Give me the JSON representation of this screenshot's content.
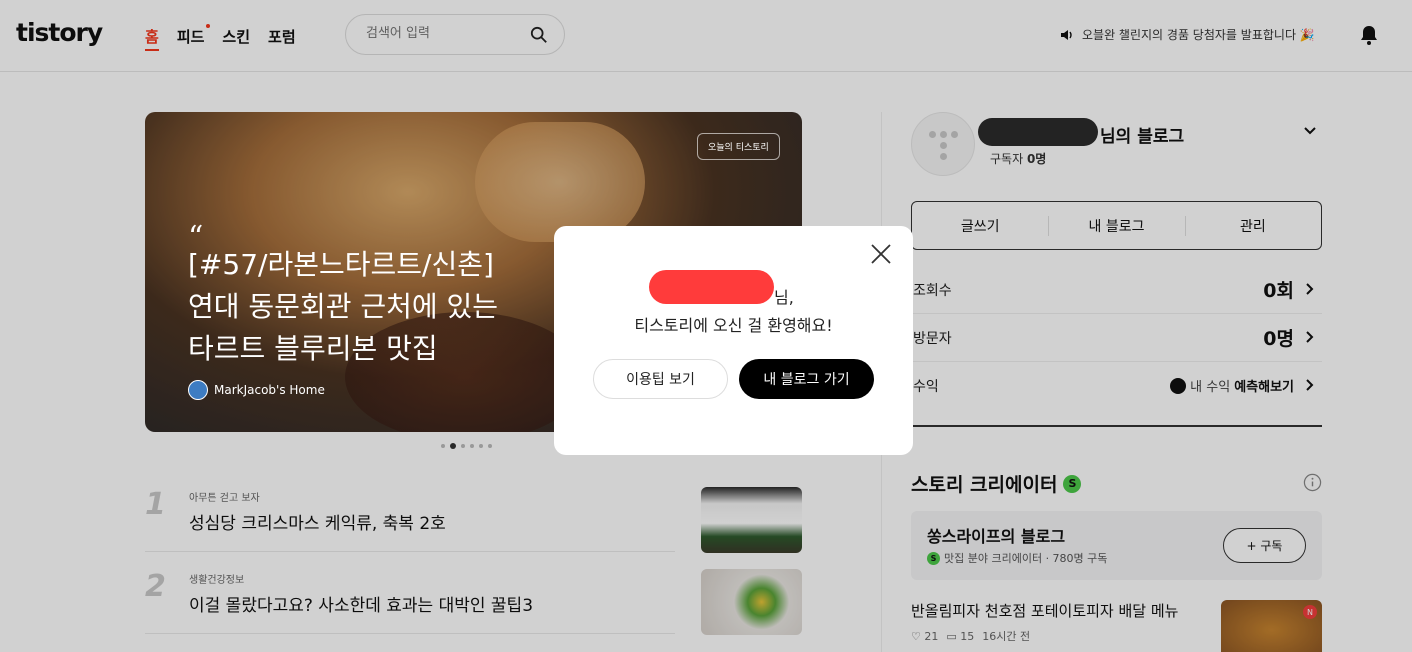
{
  "header": {
    "logo": "tistory",
    "nav": [
      "홈",
      "피드",
      "스킨",
      "포럼"
    ],
    "search_placeholder": "검색어 입력",
    "notice": "오블완 챌린지의 경품 당첨자를 발표합니다 🎉"
  },
  "hero": {
    "badge": "오늘의 티스토리",
    "quote_mark": "“",
    "title_lines": [
      "[#57/라본느타르트/신촌]",
      "연대 동문회관 근처에 있는",
      "타르트 블루리본 맛집"
    ],
    "author": "MarkJacob's Home"
  },
  "ranking": [
    {
      "rank": "1",
      "category": "아무튼 걷고 보자",
      "title": "성심당 크리스마스 케익류, 축복 2호"
    },
    {
      "rank": "2",
      "category": "생활건강정보",
      "title": "이걸 몰랐다고요? 사소한데 효과는 대박인 꿀팁3"
    }
  ],
  "profile": {
    "blog_suffix": "님의 블로그",
    "subscribers_label": "구독자",
    "subscribers_value": "0명",
    "buttons": [
      "글쓰기",
      "내 블로그",
      "관리"
    ],
    "stats": [
      {
        "label": "조회수",
        "value": "0회"
      },
      {
        "label": "방문자",
        "value": "0명"
      }
    ],
    "revenue_label": "수익",
    "revenue_text": "내 수익",
    "revenue_action": "예측해보기"
  },
  "creator": {
    "section_title": "스토리 크리에이터",
    "badge": "S",
    "card_name": "쏭스라이프의 블로그",
    "card_meta": "맛집 분야 크리에이터 · 780명 구독",
    "subscribe_button": "+ 구독"
  },
  "post": {
    "title": "반올림피자 천호점 포테이토피자 배달 메뉴",
    "likes": "21",
    "comments": "15",
    "time": "16시간 전",
    "thumb_badge": "N"
  },
  "modal": {
    "name_suffix": "님,",
    "welcome": "티스토리에 오신 걸 환영해요!",
    "tip_button": "이용팁 보기",
    "blog_button": "내 블로그 가기"
  },
  "colors": {
    "accent": "#f5361b",
    "mask_name": "#ff3b3b",
    "mask_blog": "#2b2b2b",
    "creator_green": "#4cc84a"
  }
}
